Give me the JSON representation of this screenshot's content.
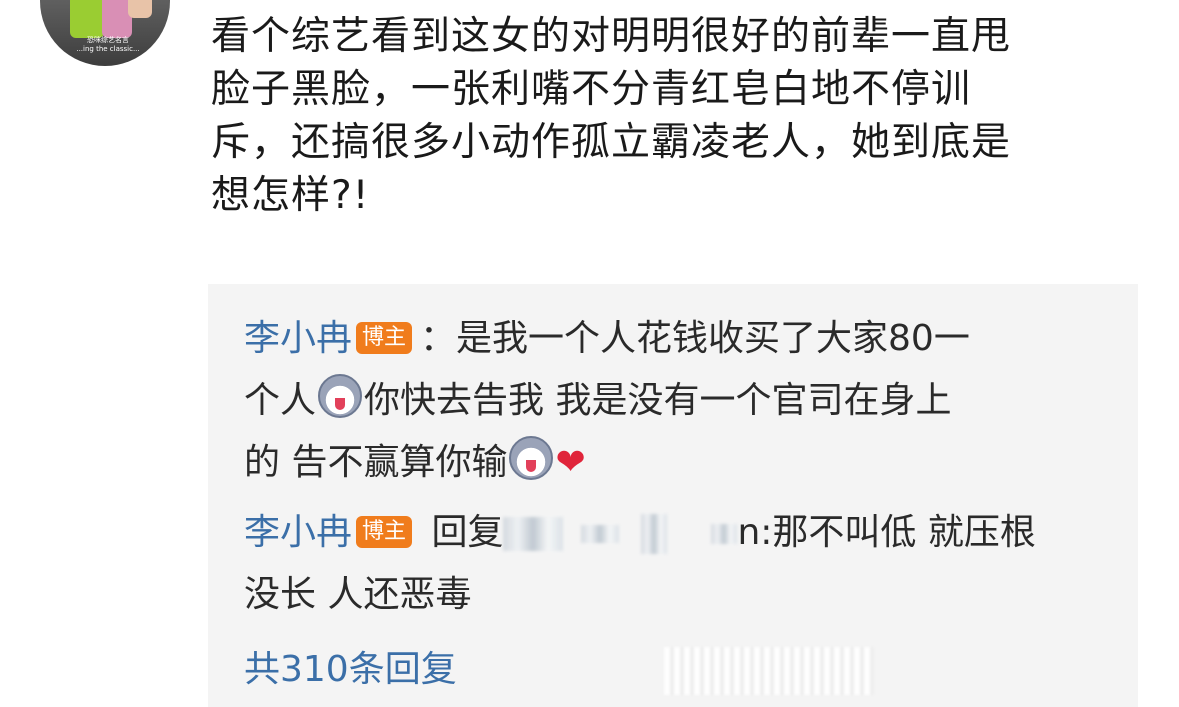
{
  "avatar": {
    "caption_line1": "恐咪综艺名言",
    "caption_line2": "...ing the classic..."
  },
  "post": {
    "text": "看个综艺看到这女的对明明很好的前辈一直甩\n脸子黑脸，一张利嘴不分青红皂白地不停训\n斥，还搞很多小动作孤立霸凌老人，她到底是\n想怎样?!"
  },
  "replies": [
    {
      "username": "李小冉",
      "badge": "博主",
      "line1": "：是我一个人花钱收买了大家80一",
      "line2a": "个人",
      "line2b": "你快去告我 我是没有一个官司在身上",
      "line3a": "的 告不赢算你输",
      "emoji": "doge-emoji",
      "heart": "❤"
    },
    {
      "username": "李小冉",
      "badge": "博主",
      "prefix": " 回复",
      "suffix": "n:那不叫低 就压根",
      "line2": "没长 人还恶毒"
    }
  ],
  "total_replies": "共310条回复",
  "colors": {
    "username": "#3b6fa8",
    "badge": "#f07c1c",
    "reply_bg": "#f4f4f4",
    "heart": "#e0243a"
  }
}
